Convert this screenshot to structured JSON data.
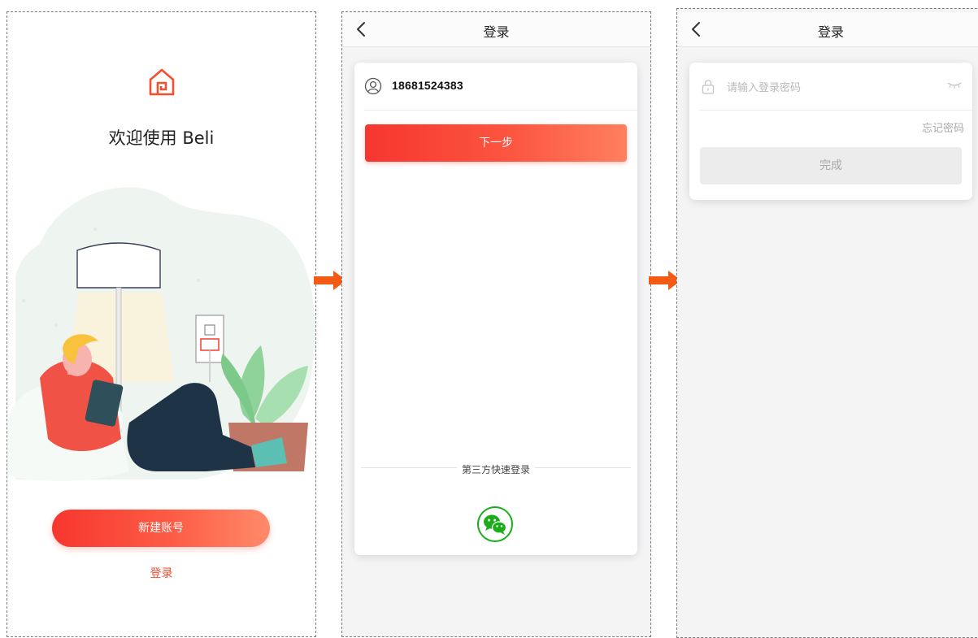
{
  "colors": {
    "accent": "#f6362f",
    "accent_light": "#ff8a6a",
    "wechat_green": "#1aad19",
    "flow_arrow": "#f35a13"
  },
  "welcome_screen": {
    "logo_icon": "home-icon",
    "title": "欢迎使用 Beli",
    "illustration": "person-with-tablet-lamp-socket-plant",
    "create_account_label": "新建账号",
    "login_label": "登录"
  },
  "phone_screen": {
    "nav_title": "登录",
    "back_icon": "chevron-left-icon",
    "user_icon": "user-circle-icon",
    "phone_number": "18681524383",
    "next_label": "下一步",
    "third_party_label": "第三方快速登录",
    "wechat_icon": "wechat-icon"
  },
  "password_screen": {
    "nav_title": "登录",
    "back_icon": "chevron-left-icon",
    "lock_icon": "lock-icon",
    "password_placeholder": "请输入登录密码",
    "eye_icon": "eye-closed-icon",
    "forgot_label": "忘记密码",
    "done_label": "完成"
  }
}
